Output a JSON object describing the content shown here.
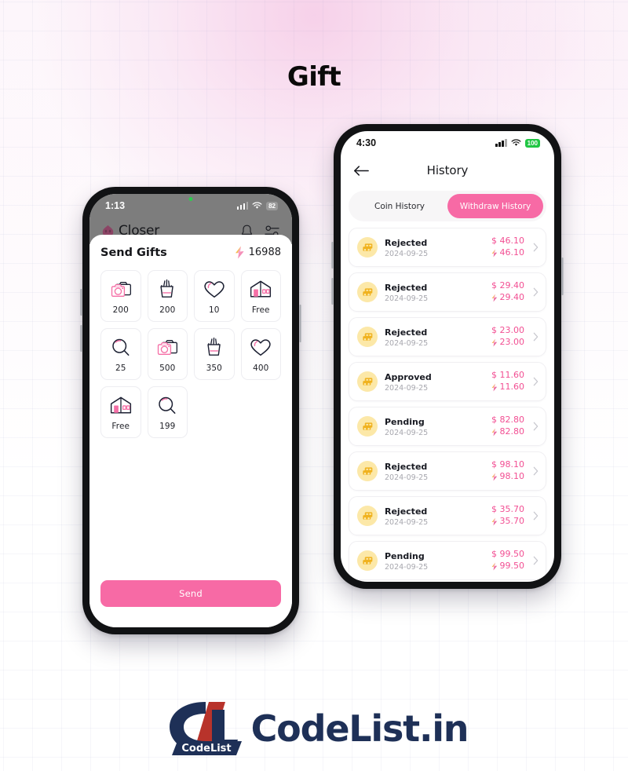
{
  "page": {
    "title": "Gift",
    "accent_pink": "#f76aa5",
    "accent_pink_text": "#f24f93",
    "brand_navy": "#1e3057"
  },
  "footer": {
    "badge_text": "CodeList",
    "wordmark": "CodeList.in"
  },
  "left_phone": {
    "status": {
      "time": "1:13",
      "battery": "82",
      "wifi_icon": "wifi-icon",
      "signal_icon": "cellular-signal-icon"
    },
    "app_bar": {
      "brand": "Closer",
      "logo_icon": "closer-flame-icon",
      "bell_icon": "notification-bell-icon",
      "filter_icon": "filter-sliders-icon"
    },
    "sheet": {
      "title": "Send Gifts",
      "coin_icon": "lightning-bolt-icon",
      "coin_balance": "16988",
      "send_label": "Send",
      "gifts": [
        {
          "icon": "camera-icon",
          "label": "200"
        },
        {
          "icon": "fries-icon",
          "label": "200"
        },
        {
          "icon": "heart-icon",
          "label": "10"
        },
        {
          "icon": "house-icon",
          "label": "Free"
        },
        {
          "icon": "magnifier-icon",
          "label": "25"
        },
        {
          "icon": "camera-icon",
          "label": "500"
        },
        {
          "icon": "fries-icon",
          "label": "350"
        },
        {
          "icon": "heart-icon",
          "label": "400"
        },
        {
          "icon": "house-icon",
          "label": "Free"
        },
        {
          "icon": "magnifier-icon",
          "label": "199"
        }
      ]
    }
  },
  "right_phone": {
    "status": {
      "time": "4:30",
      "battery": "100",
      "wifi_icon": "wifi-icon",
      "signal_icon": "cellular-signal-icon"
    },
    "nav": {
      "title": "History",
      "back_icon": "back-arrow-icon"
    },
    "tabs": [
      {
        "label": "Coin History",
        "active": false
      },
      {
        "label": "Withdraw History",
        "active": true
      }
    ],
    "history": [
      {
        "icon": "wallet-icon",
        "status": "Rejected",
        "date": "2024-09-25",
        "dollar": "$ 46.10",
        "coins": "46.10",
        "chevron": "chevron-right-icon"
      },
      {
        "icon": "wallet-icon",
        "status": "Rejected",
        "date": "2024-09-25",
        "dollar": "$ 29.40",
        "coins": "29.40",
        "chevron": "chevron-right-icon"
      },
      {
        "icon": "wallet-icon",
        "status": "Rejected",
        "date": "2024-09-25",
        "dollar": "$ 23.00",
        "coins": "23.00",
        "chevron": "chevron-right-icon"
      },
      {
        "icon": "wallet-icon",
        "status": "Approved",
        "date": "2024-09-25",
        "dollar": "$ 11.60",
        "coins": "11.60",
        "chevron": "chevron-right-icon"
      },
      {
        "icon": "wallet-icon",
        "status": "Pending",
        "date": "2024-09-25",
        "dollar": "$ 82.80",
        "coins": "82.80",
        "chevron": "chevron-right-icon"
      },
      {
        "icon": "wallet-icon",
        "status": "Rejected",
        "date": "2024-09-25",
        "dollar": "$ 98.10",
        "coins": "98.10",
        "chevron": "chevron-right-icon"
      },
      {
        "icon": "wallet-icon",
        "status": "Rejected",
        "date": "2024-09-25",
        "dollar": "$ 35.70",
        "coins": "35.70",
        "chevron": "chevron-right-icon"
      },
      {
        "icon": "wallet-icon",
        "status": "Pending",
        "date": "2024-09-25",
        "dollar": "$ 99.50",
        "coins": "99.50",
        "chevron": "chevron-right-icon"
      }
    ]
  }
}
